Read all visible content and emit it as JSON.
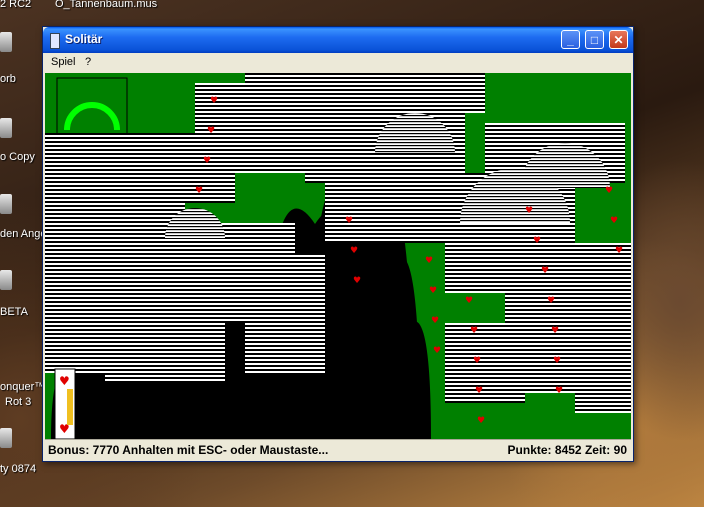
{
  "desktop": {
    "labels": [
      "2 RC2",
      "O_Tannenbaum.mus",
      "orb",
      "o Copy",
      "den Ange",
      "BETA",
      "onquer™",
      "Rot 3",
      "ty 0874"
    ]
  },
  "window": {
    "title": "Solitär",
    "controls": {
      "minimize": "_",
      "maximize": "□",
      "close": "✕"
    },
    "menu": [
      "Spiel",
      "?"
    ]
  },
  "status": {
    "message": "Bonus: 7770  Anhalten mit ESC- oder Maustaste...",
    "score_label": "Punkte:",
    "score": "8452",
    "time_label": "Zeit:",
    "time": "90"
  },
  "colors": {
    "felt": "#008000",
    "card_outline": "#000000",
    "heart_red": "#e00000"
  }
}
